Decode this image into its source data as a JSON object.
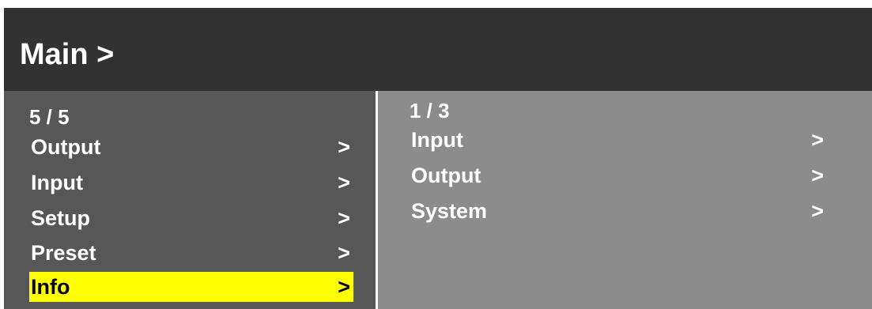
{
  "header": {
    "title": "Main >"
  },
  "left_menu": {
    "counter": "5 / 5",
    "items": [
      {
        "label": "Output",
        "arrow": ">"
      },
      {
        "label": "Input",
        "arrow": ">"
      },
      {
        "label": "Setup",
        "arrow": ">"
      },
      {
        "label": "Preset",
        "arrow": ">"
      },
      {
        "label": "Info",
        "arrow": ">",
        "selected": true
      }
    ]
  },
  "right_menu": {
    "counter": "1 / 3",
    "items": [
      {
        "label": "Input",
        "arrow": ">"
      },
      {
        "label": "Output",
        "arrow": ">"
      },
      {
        "label": "System",
        "arrow": ">"
      }
    ]
  },
  "colors": {
    "header_bg": "#323232",
    "left_panel_bg": "#575757",
    "right_panel_bg": "#8c8c8c",
    "selection_highlight": "#ffff00",
    "text": "#ffffff"
  }
}
